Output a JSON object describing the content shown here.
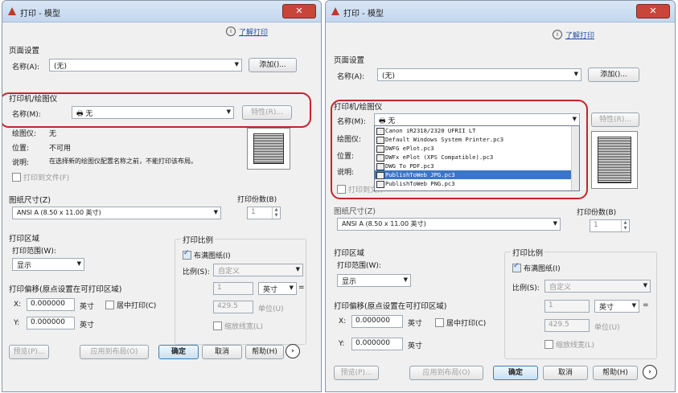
{
  "left": {
    "title": "打印 - 模型",
    "help_link": "了解打印",
    "page_setup": {
      "section": "页面设置",
      "name_label": "名称(A):",
      "name_value": "(无)",
      "add_button": "添加()..."
    },
    "printer": {
      "section": "打印机/绘图仪",
      "name_label": "名称(M):",
      "name_value": "无",
      "properties_button": "特性(R)...",
      "plotter_label": "绘图仪:",
      "plotter_value": "无",
      "location_label": "位置:",
      "location_value": "不可用",
      "desc_label": "说明:",
      "desc_value": "在选择新的绘图仪配置名称之前，不能打印该布局。",
      "print_to_file": "打印到文件(F)"
    },
    "paper": {
      "section": "图纸尺寸(Z)",
      "value": "ANSI A (8.50 x 11.00 英寸)"
    },
    "copies": {
      "label": "打印份数(B)",
      "value": "1"
    },
    "area": {
      "section": "打印区域",
      "range_label": "打印范围(W):",
      "range_value": "显示"
    },
    "offset": {
      "section": "打印偏移(原点设置在可打印区域)",
      "x_label": "X:",
      "x_value": "0.000000",
      "x_unit": "英寸",
      "center": "居中打印(C)",
      "y_label": "Y:",
      "y_value": "0.000000",
      "y_unit": "英寸"
    },
    "scale": {
      "section": "打印比例",
      "fit": "布满图纸(I)",
      "scale_label": "比例(S):",
      "scale_value": "自定义",
      "v1": "1",
      "unit": "英寸",
      "v2": "429.5",
      "unit2": "单位(U)",
      "lineweight": "缩放线宽(L)"
    },
    "buttons": {
      "preview": "预览(P)...",
      "apply": "应用到布局(O)",
      "ok": "确定",
      "cancel": "取消",
      "help": "帮助(H)",
      "more": "›"
    }
  },
  "right": {
    "title": "打印 - 模型",
    "help_link": "了解打印",
    "page_setup": {
      "section": "页面设置",
      "name_label": "名称(A):",
      "name_value": "(无)",
      "add_button": "添加()..."
    },
    "printer": {
      "section": "打印机/绘图仪",
      "name_label": "名称(M):",
      "name_value": "无",
      "properties_button": "特性(R)...",
      "plotter_label": "绘图仪:",
      "location_label": "位置:",
      "desc_label": "说明:",
      "print_to_file": "打印到文件"
    },
    "dropdown_items": [
      "Canon iR2318/2320 UFRII LT",
      "Default Windows System Printer.pc3",
      "DWFG ePlot.pc3",
      "DWFx ePlot (XPS Compatible).pc3",
      "DWG To PDF.pc3",
      "PublishToWeb JPG.pc3",
      "PublishToWeb PNG.pc3"
    ],
    "dropdown_selected": 5,
    "paper": {
      "section": "图纸尺寸(Z)",
      "value": "ANSI A (8.50 x 11.00 英寸)"
    },
    "copies": {
      "label": "打印份数(B)",
      "value": "1"
    },
    "area": {
      "section": "打印区域",
      "range_label": "打印范围(W):",
      "range_value": "显示"
    },
    "offset": {
      "section": "打印偏移(原点设置在可打印区域)",
      "x_label": "X:",
      "x_value": "0.000000",
      "x_unit": "英寸",
      "center": "居中打印(C)",
      "y_label": "Y:",
      "y_value": "0.000000",
      "y_unit": "英寸"
    },
    "scale": {
      "section": "打印比例",
      "fit": "布满图纸(I)",
      "scale_label": "比例(S):",
      "scale_value": "自定义",
      "v1": "1",
      "unit": "英寸",
      "v2": "429.5",
      "unit2": "单位(U)",
      "lineweight": "缩放线宽(L)"
    },
    "buttons": {
      "preview": "预览(P)...",
      "apply": "应用到布局(O)",
      "ok": "确定",
      "cancel": "取消",
      "help": "帮助(H)",
      "more": "›"
    }
  },
  "colors": {
    "highlight": "#c4242b",
    "selection": "#3a76c9"
  }
}
